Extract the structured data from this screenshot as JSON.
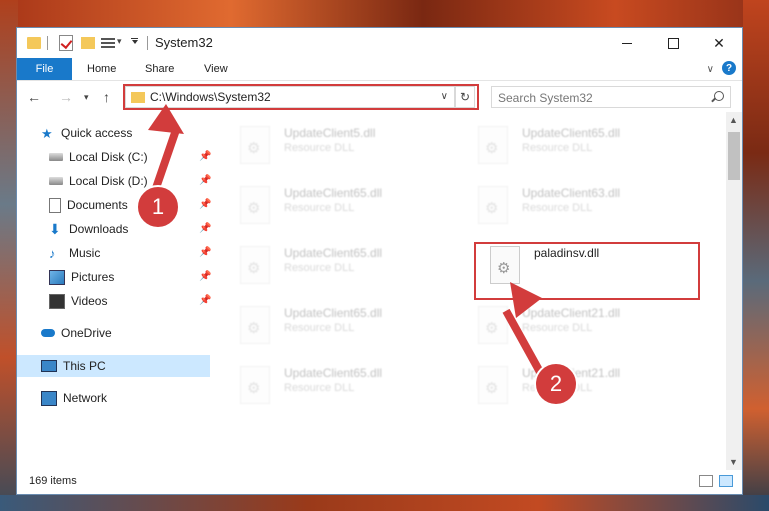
{
  "window": {
    "title": "System32"
  },
  "ribbon": {
    "file": "File",
    "home": "Home",
    "share": "Share",
    "view": "View",
    "help": "?"
  },
  "address": {
    "path": "C:\\Windows\\System32"
  },
  "search": {
    "placeholder": "Search System32"
  },
  "sidebar": {
    "items": [
      {
        "label": "Quick access",
        "icon": "star-icon"
      },
      {
        "label": "Local Disk (C:)",
        "icon": "drive-icon",
        "pinned": true
      },
      {
        "label": "Local Disk (D:)",
        "icon": "drive-icon",
        "pinned": true
      },
      {
        "label": "Documents",
        "icon": "documents-icon",
        "pinned": true
      },
      {
        "label": "Downloads",
        "icon": "downloads-icon",
        "pinned": true
      },
      {
        "label": "Music",
        "icon": "music-icon",
        "pinned": true
      },
      {
        "label": "Pictures",
        "icon": "pictures-icon",
        "pinned": true
      },
      {
        "label": "Videos",
        "icon": "videos-icon",
        "pinned": true
      },
      {
        "label": "OneDrive",
        "icon": "onedrive-icon"
      },
      {
        "label": "This PC",
        "icon": "pc-icon",
        "selected": true
      },
      {
        "label": "Network",
        "icon": "network-icon"
      }
    ]
  },
  "files": [
    {
      "name": "UpdateClient5.dll",
      "type": "Resource DLL"
    },
    {
      "name": "UpdateClient65.dll",
      "type": "Resource DLL"
    },
    {
      "name": "UpdateClient65.dll",
      "type": "Resource DLL"
    },
    {
      "name": "UpdateClient63.dll",
      "type": "Resource DLL"
    },
    {
      "name": "UpdateClient65.dll",
      "type": "Resource DLL"
    },
    {
      "name": "paladinsv.dll",
      "type": ""
    },
    {
      "name": "UpdateClient65.dll",
      "type": "Resource DLL"
    },
    {
      "name": "UpdateClient21.dll",
      "type": "Resource DLL"
    },
    {
      "name": "UpdateClient65.dll",
      "type": "Resource DLL"
    },
    {
      "name": "UpdateClient21.dll",
      "type": "Resource DLL"
    }
  ],
  "status": {
    "item_count": "169 items"
  },
  "markers": {
    "one": "1",
    "two": "2"
  },
  "colors": {
    "accent": "#1979ca",
    "highlight": "#d23c3c",
    "selected_bg": "#cce8ff"
  }
}
